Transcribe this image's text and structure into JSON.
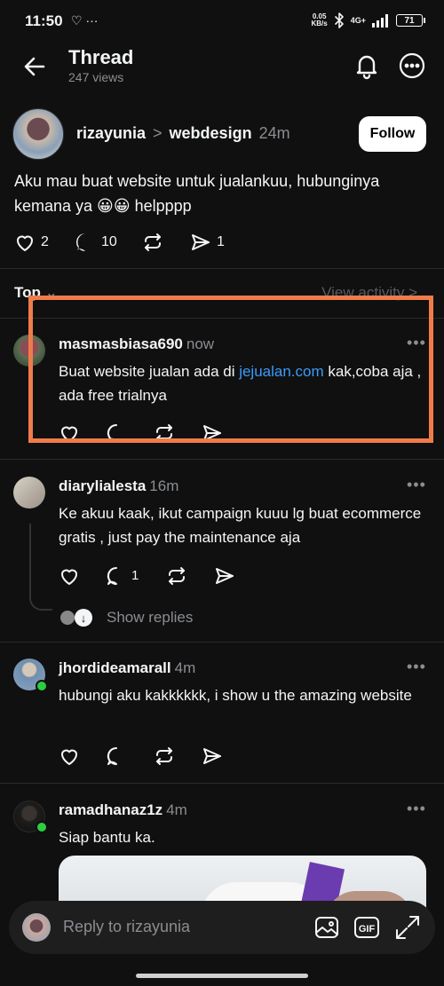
{
  "status": {
    "time": "11:50",
    "left_icons": "♡ ···",
    "speed_top": "0.05",
    "speed_bottom": "KB/s",
    "network": "4G+",
    "battery": "71"
  },
  "header": {
    "title": "Thread",
    "views": "247 views"
  },
  "post": {
    "username": "rizayunia",
    "separator": ">",
    "community": "webdesign",
    "time": "24m",
    "follow_label": "Follow",
    "text": "Aku mau buat website untuk jualankuu, hubunginya kemana ya 😀😀 helpppp",
    "likes": "2",
    "comments": "10",
    "shares": "1"
  },
  "sort": {
    "label": "Top",
    "view_activity": "View activity >"
  },
  "comments": [
    {
      "username": "masmasbiasa690",
      "time": "now",
      "text_before": "Buat website jualan ada di ",
      "link": "jejualan.com",
      "text_after": " kak,coba aja , ada free trialnya"
    },
    {
      "username": "diarylialesta",
      "time": "16m",
      "text": "Ke akuu kaak, ikut campaign kuuu lg buat ecommerce gratis , just pay the maintenance aja",
      "reply_count": "1",
      "show_replies": "Show replies"
    },
    {
      "username": "jhordideamarall",
      "time": "4m",
      "text": "hubungi aku kakkkkkk, i show u the amazing website"
    },
    {
      "username": "ramadhanaz1z",
      "time": "4m",
      "text": "Siap bantu ka."
    }
  ],
  "reply_bar": {
    "placeholder": "Reply to rizayunia"
  },
  "colors": {
    "background": "#101010",
    "link": "#3a9bfa",
    "highlight": "#f07b4a",
    "online": "#2ecc40"
  }
}
